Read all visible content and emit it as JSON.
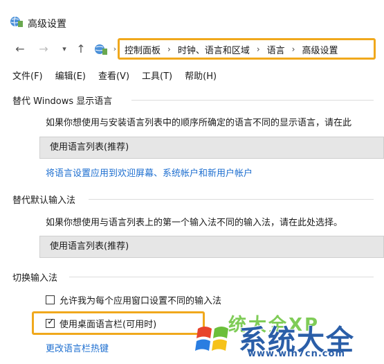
{
  "window": {
    "title": "高级设置"
  },
  "nav": {
    "breadcrumb": [
      "控制面板",
      "时钟、语言和区域",
      "语言",
      "高级设置"
    ]
  },
  "menu": [
    "文件(F)",
    "编辑(E)",
    "查看(V)",
    "工具(T)",
    "帮助(H)"
  ],
  "display_language": {
    "heading": "替代 Windows 显示语言",
    "description": "如果你想使用与安装语言列表中的顺序所确定的语言不同的显示语言，请在此",
    "selected": "使用语言列表(推荐)",
    "link": "将语言设置应用到欢迎屏幕、系统帐户和新用户帐户"
  },
  "input_method": {
    "heading": "替代默认输入法",
    "description": "如果你想使用与语言列表上的第一个输入法不同的输入法，请在此处选择。",
    "selected": "使用语言列表(推荐)"
  },
  "switch_input": {
    "heading": "切换输入法",
    "per_window": {
      "label": "允许我为每个应用窗口设置不同的输入法",
      "checked": false
    },
    "language_bar": {
      "label": "使用桌面语言栏(可用时)",
      "checked": true
    },
    "hotkeys_link": "更改语言栏热键"
  },
  "watermark": {
    "text": "系统大全",
    "url": "www.win7cn.com",
    "overlay": "统大全XP"
  },
  "colors": {
    "highlight": "#f0a81c",
    "link": "#1e6fd0",
    "select_bg": "#e6e6e6"
  }
}
